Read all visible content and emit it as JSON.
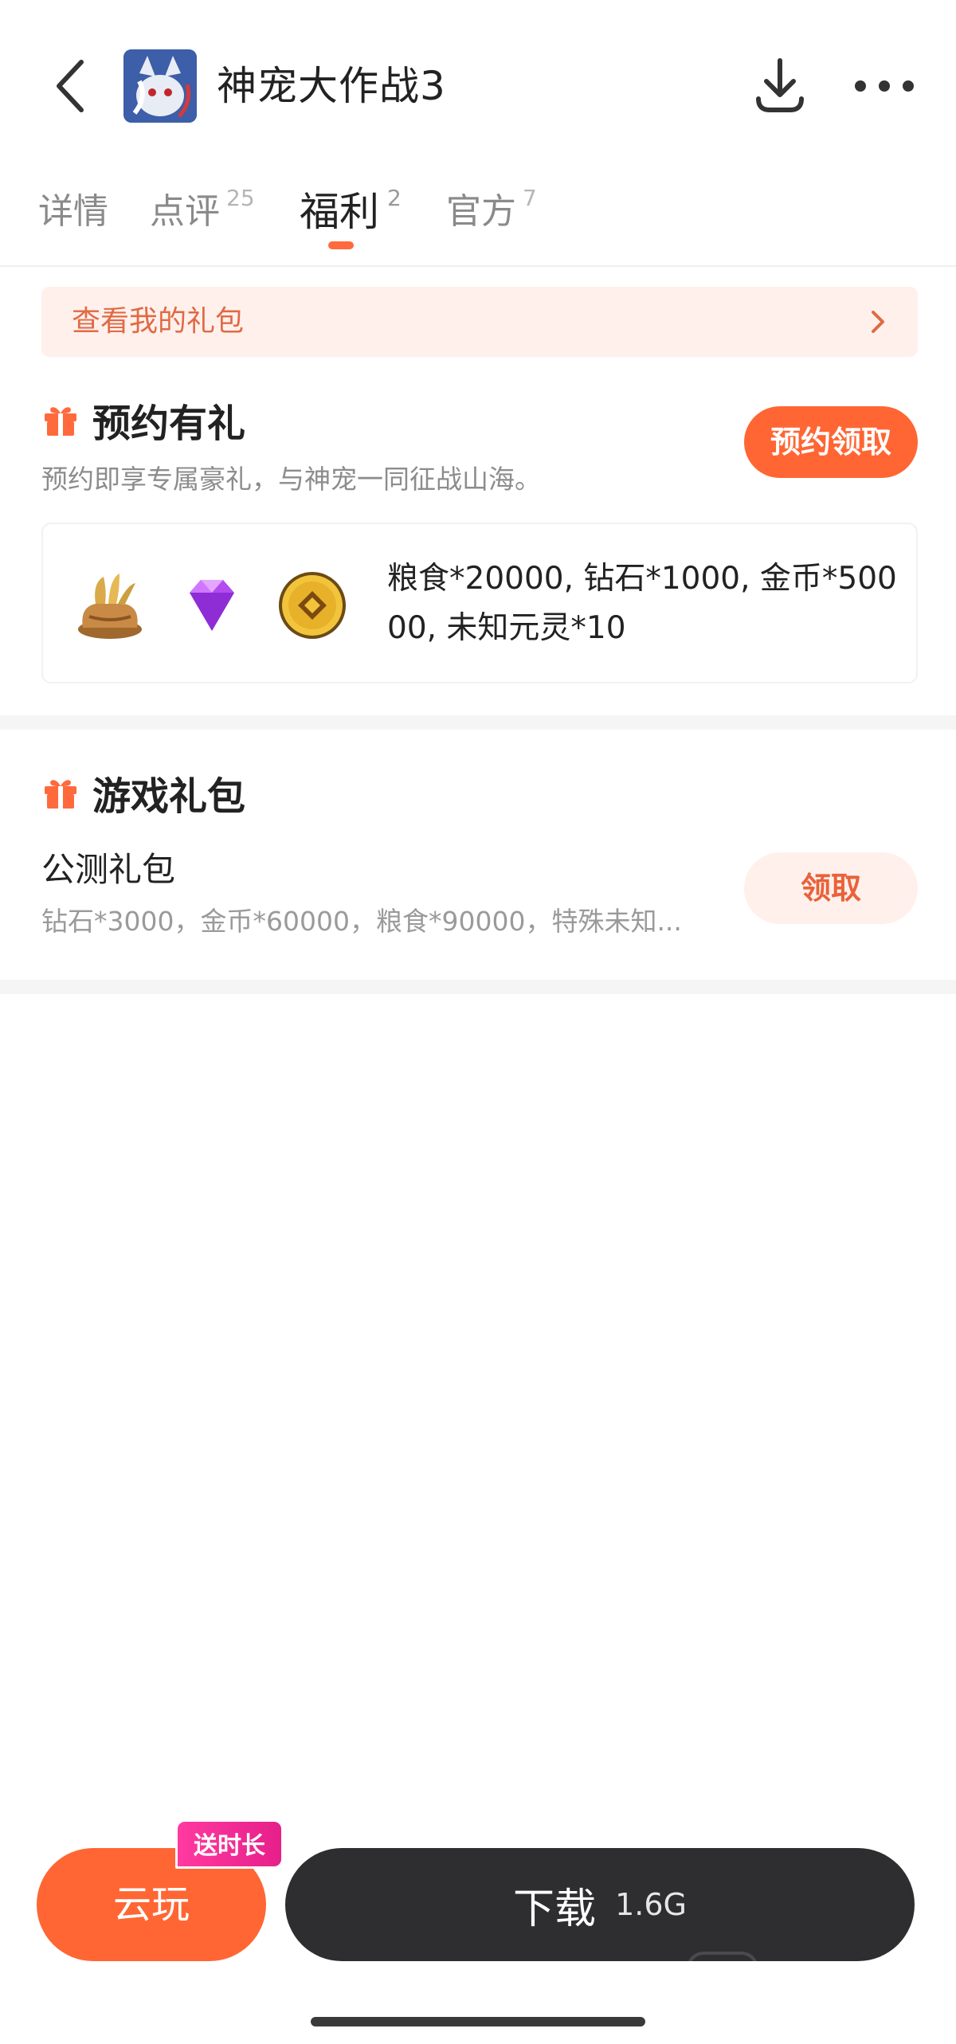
{
  "header": {
    "title": "神宠大作战3",
    "icons": {
      "back": "chevron-left-icon",
      "download": "download-icon",
      "more": "more-dots-icon"
    }
  },
  "tabs": [
    {
      "label": "详情",
      "count": ""
    },
    {
      "label": "点评",
      "count": "25"
    },
    {
      "label": "福利",
      "count": "2",
      "active": true
    },
    {
      "label": "官方",
      "count": "7"
    }
  ],
  "my_gifts": {
    "label": "查看我的礼包"
  },
  "reserve": {
    "title": "预约有礼",
    "description": "预约即享专属豪礼，与神宠一同征战山海。",
    "button": "预约领取",
    "rewards_icons": [
      "grain-sack-icon",
      "purple-diamond-icon",
      "gold-coin-icon"
    ],
    "rewards_text": "粮食*20000, 钻石*1000, 金币*50000, 未知元灵*10"
  },
  "game_gifts": {
    "title": "游戏礼包",
    "items": [
      {
        "name": "公测礼包",
        "description": "钻石*3000，金币*60000，粮食*90000，特殊未知...",
        "button": "领取"
      }
    ]
  },
  "bottom_bar": {
    "cloud_play": "云玩",
    "promo_badge": "送时长",
    "download": "下载",
    "size": "1.6G"
  },
  "colors": {
    "accent": "#ff6633",
    "accent_light": "#fff0ec",
    "dark_button": "#2e2e30",
    "badge": "#e61f8a"
  }
}
